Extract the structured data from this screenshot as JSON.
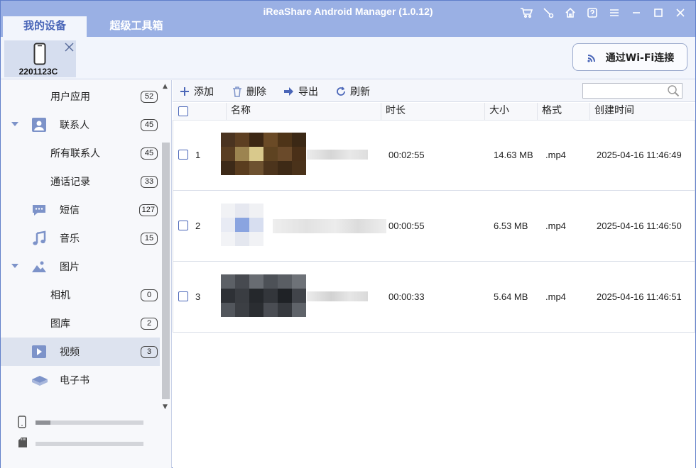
{
  "app": {
    "title": "iReaShare Android Manager (1.0.12)",
    "tabs": [
      {
        "label": "我的设备"
      },
      {
        "label": "超级工具箱"
      }
    ]
  },
  "device": {
    "name": "2201123C"
  },
  "wifi_button": {
    "label": "通过Wi-Fi连接"
  },
  "sidebar": {
    "items": [
      {
        "label": "用户应用",
        "count": "52"
      },
      {
        "label": "联系人",
        "count": "45"
      },
      {
        "label": "所有联系人",
        "count": "45"
      },
      {
        "label": "通话记录",
        "count": "33"
      },
      {
        "label": "短信",
        "count": "127"
      },
      {
        "label": "音乐",
        "count": "15"
      },
      {
        "label": "图片",
        "count": ""
      },
      {
        "label": "相机",
        "count": "0"
      },
      {
        "label": "图库",
        "count": "2"
      },
      {
        "label": "视频",
        "count": "3"
      },
      {
        "label": "电子书",
        "count": ""
      }
    ],
    "storage": [
      {
        "icon": "phone-storage-icon",
        "used_fraction": 0.14
      },
      {
        "icon": "sd-card-icon",
        "used_fraction": 0.0
      }
    ]
  },
  "toolbar": {
    "add": "添加",
    "delete": "删除",
    "export": "导出",
    "refresh": "刷新",
    "search_placeholder": ""
  },
  "table": {
    "columns": [
      "名称",
      "时长",
      "大小",
      "格式",
      "创建时间"
    ],
    "rows": [
      {
        "index": "1",
        "duration": "00:02:55",
        "size": "14.63 MB",
        "format": ".mp4",
        "created": "2025-04-16 11:46:49"
      },
      {
        "index": "2",
        "duration": "00:00:55",
        "size": "6.53 MB",
        "format": ".mp4",
        "created": "2025-04-16 11:46:50"
      },
      {
        "index": "3",
        "duration": "00:00:33",
        "size": "5.64 MB",
        "format": ".mp4",
        "created": "2025-04-16 11:46:51"
      }
    ]
  },
  "colors": {
    "titlebar": "#9ab0e4",
    "accent": "#4a66b8",
    "selected": "#dde3ef"
  }
}
